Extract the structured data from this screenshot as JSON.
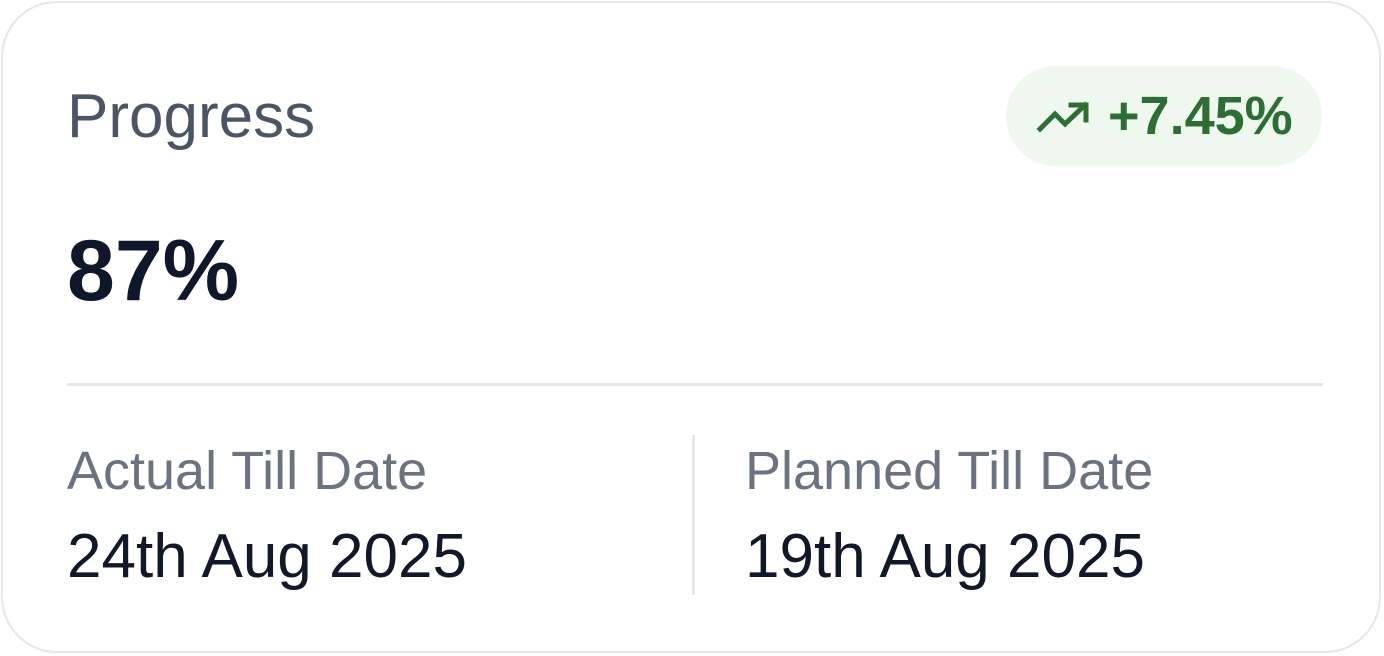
{
  "card": {
    "title": "Progress",
    "value": "87%",
    "trend": {
      "icon": "trending-up-icon",
      "label": "+7.45%",
      "color": "#2e6d34",
      "background": "#eff8ef"
    },
    "stats": [
      {
        "label": "Actual Till Date",
        "value": "24th Aug 2025"
      },
      {
        "label": "Planned Till Date",
        "value": "19th Aug 2025"
      }
    ]
  }
}
